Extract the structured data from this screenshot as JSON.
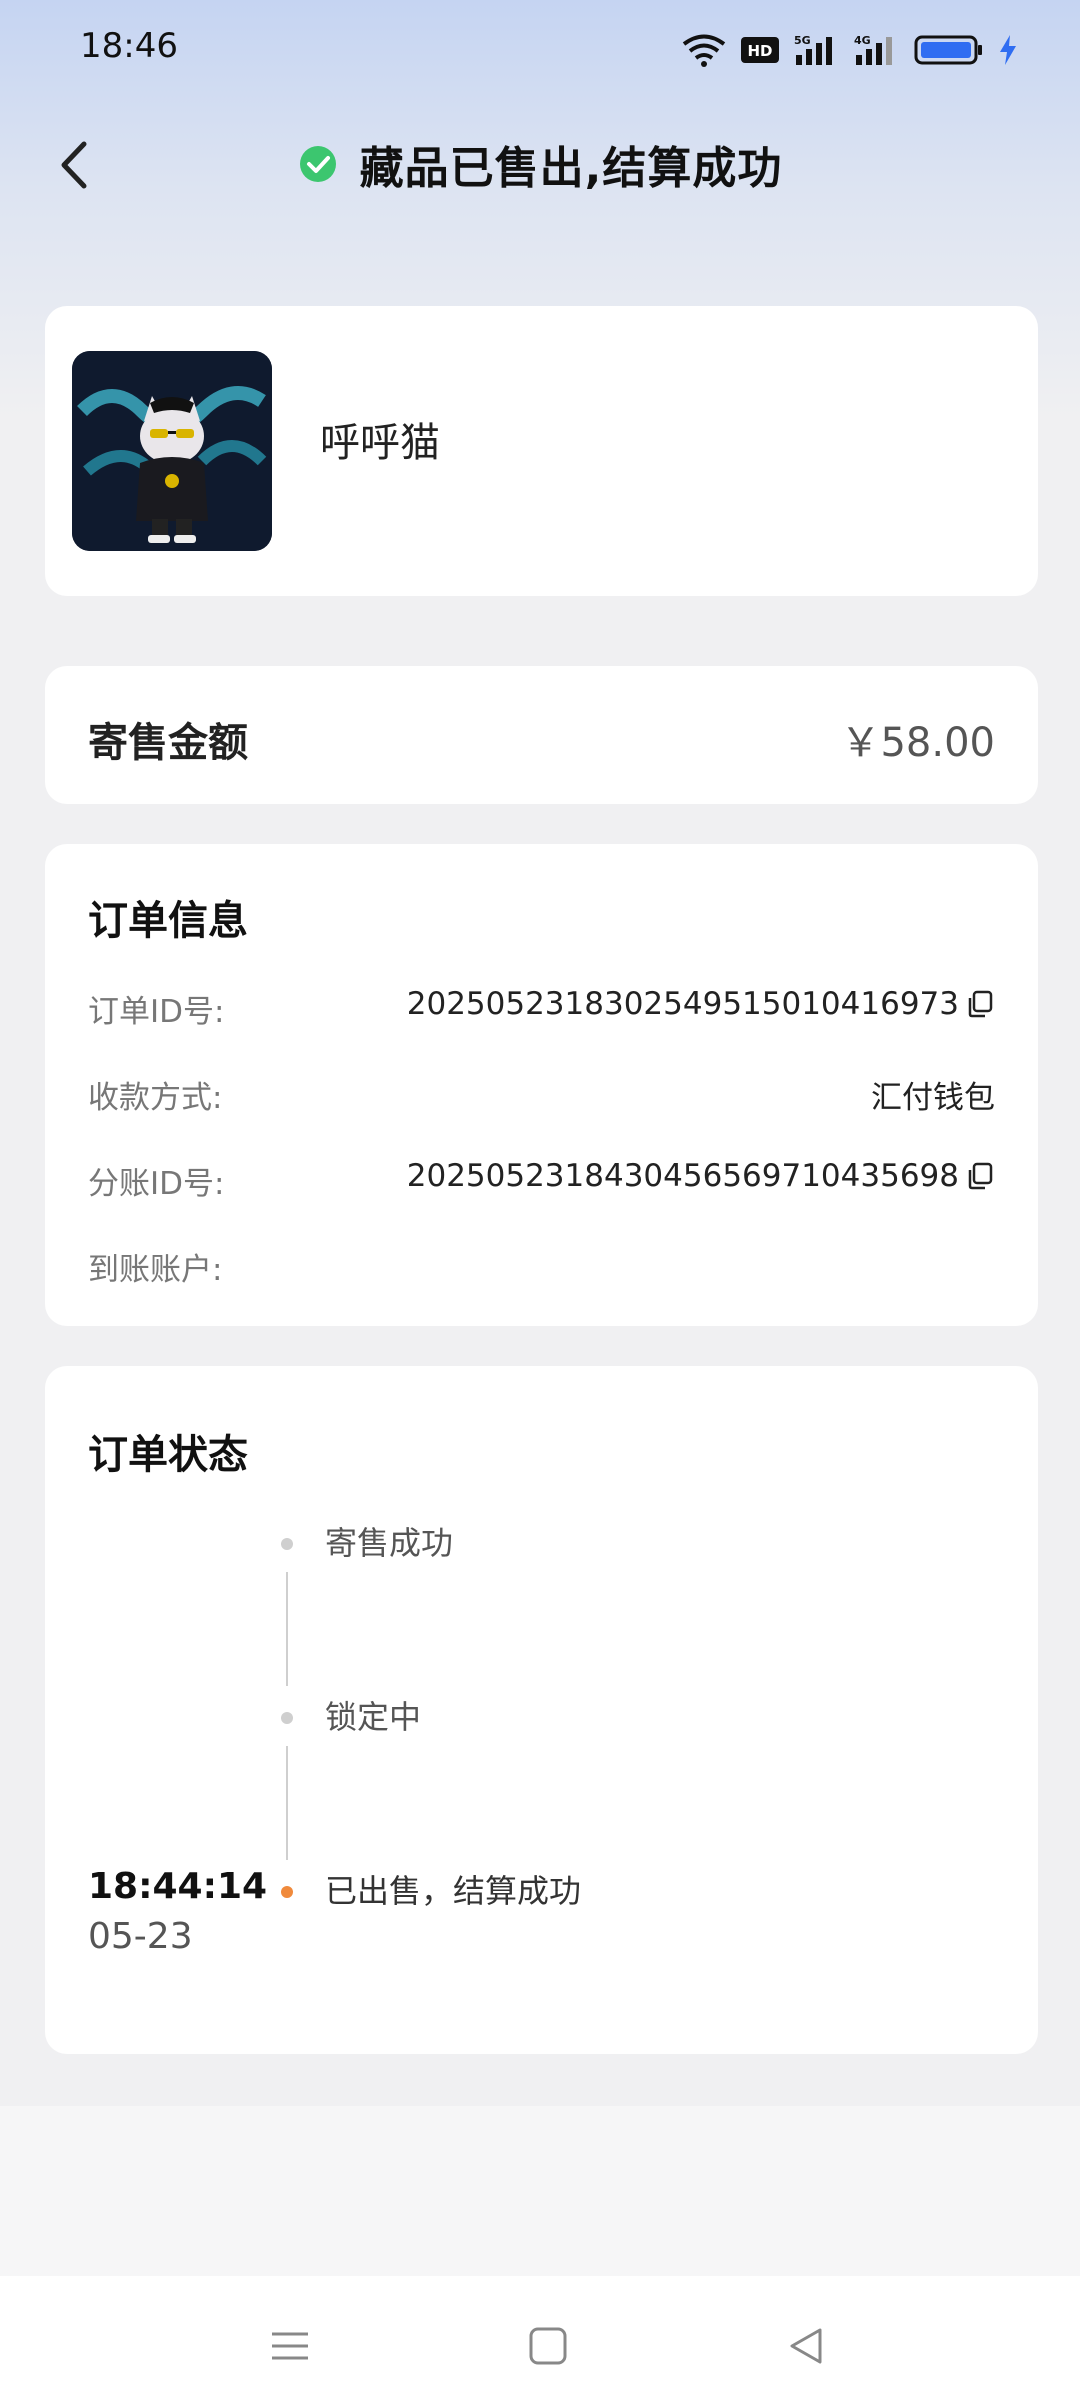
{
  "status_bar": {
    "time": "18:46",
    "icons": [
      "wifi-icon",
      "hd-icon",
      "5g-signal-icon",
      "4g-signal-icon",
      "battery-icon",
      "charging-icon"
    ]
  },
  "header": {
    "title": "藏品已售出,结算成功",
    "status_icon": "check-circle-icon",
    "accent_color": "#3cc66f"
  },
  "product": {
    "name": "呼呼猫"
  },
  "amount": {
    "label": "寄售金额",
    "value": "￥58.00"
  },
  "order_info": {
    "title": "订单信息",
    "rows": [
      {
        "label": "订单ID号:",
        "value": "20250523183025495150104169​73"
      },
      {
        "label": "收款方式:",
        "value": "汇付钱包"
      },
      {
        "label": "分账ID号:",
        "value": "202505231843045656971043569​8"
      },
      {
        "label": "到账账户:",
        "value": ""
      }
    ]
  },
  "order_status": {
    "title": "订单状态",
    "steps": [
      {
        "label": "寄售成功",
        "time": "",
        "date": ""
      },
      {
        "label": "锁定中",
        "time": "",
        "date": ""
      },
      {
        "label": "已出售，结算成功",
        "time": "18:44:14",
        "date": "05-23"
      }
    ],
    "active_color": "#f08a3c"
  },
  "nav": {
    "icons": [
      "menu-icon",
      "home-square-icon",
      "back-triangle-icon"
    ]
  }
}
